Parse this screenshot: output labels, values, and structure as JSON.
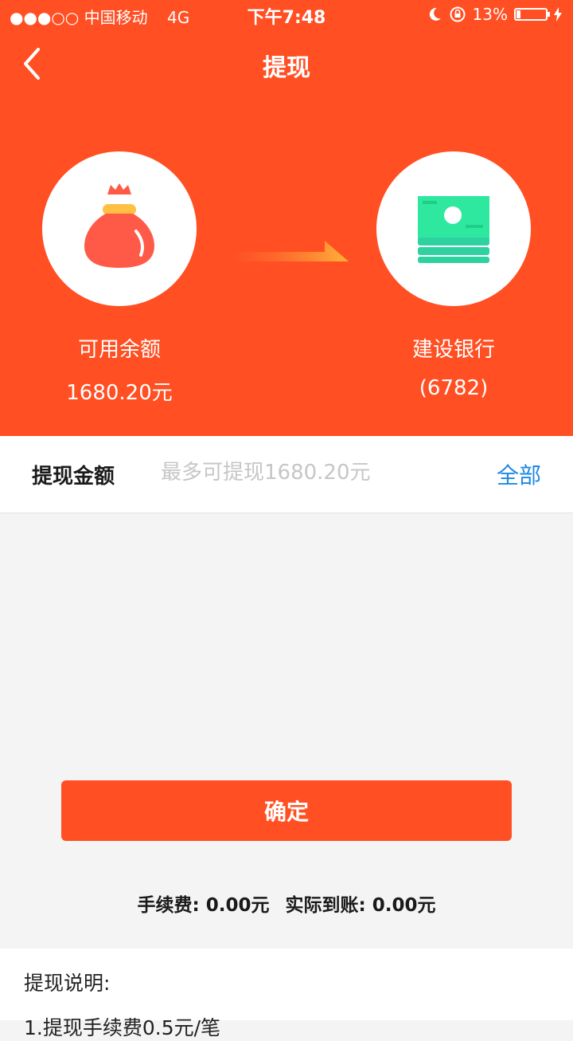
{
  "status_bar": {
    "carrier": "●●●○○ 中国移动",
    "network": "4G",
    "time": "下午7:48",
    "battery": "13%"
  },
  "header": {
    "title": "提现",
    "background_color": "#ff4f23"
  },
  "source": {
    "label": "可用余额",
    "amount": "1680.20元"
  },
  "destination": {
    "bank": "建设银行",
    "card_suffix": "(6782)"
  },
  "withdraw": {
    "label": "提现金额",
    "placeholder": "最多可提现1680.20元",
    "value": "",
    "all_button": "全部"
  },
  "confirm_button": "确定",
  "fees": {
    "fee": "手续费: 0.00元",
    "actual": "实际到账: 0.00元"
  },
  "notes": {
    "heading": "提现说明:",
    "line1": "1.提现手续费0.5元/笔"
  },
  "icons": {
    "back": "chevron-left-icon",
    "moon": "moon-icon",
    "rotation_lock": "rotation-lock-icon",
    "charging": "lightning-icon",
    "money_bag": "money-bag-icon",
    "cash": "cash-stack-icon",
    "arrow": "arrow-right-icon"
  }
}
